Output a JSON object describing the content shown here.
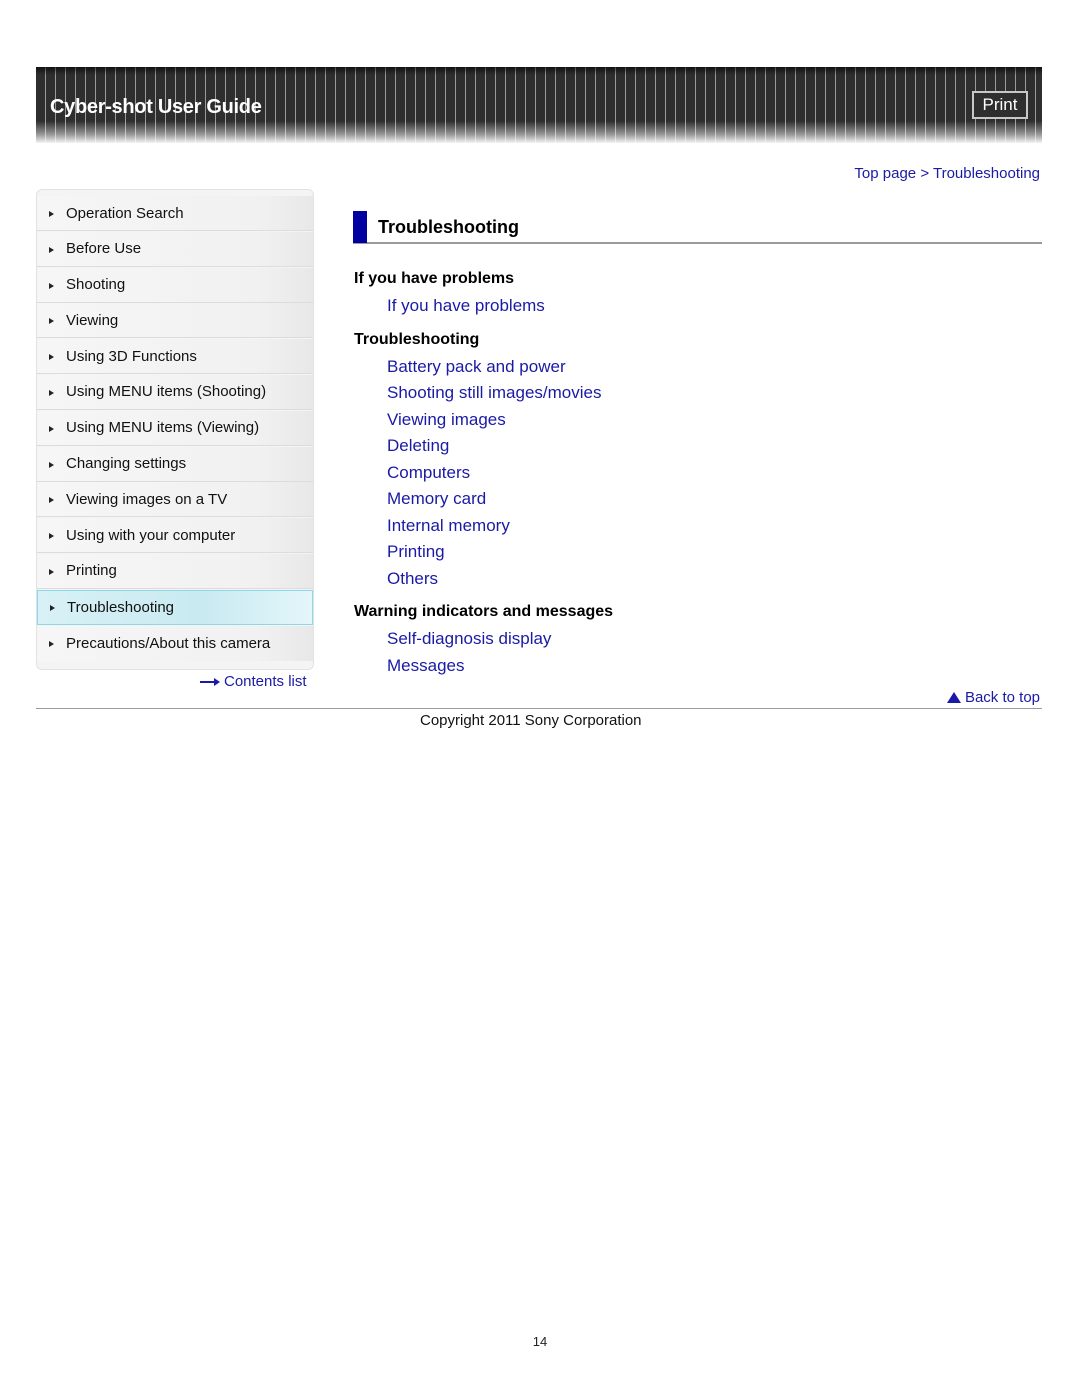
{
  "header": {
    "title": "Cyber-shot User Guide",
    "print_label": "Print"
  },
  "breadcrumb": {
    "items": [
      "Top page",
      "Troubleshooting"
    ],
    "separator": ">"
  },
  "sidebar": {
    "items": [
      {
        "label": "Operation Search"
      },
      {
        "label": "Before Use"
      },
      {
        "label": "Shooting"
      },
      {
        "label": "Viewing"
      },
      {
        "label": "Using 3D Functions"
      },
      {
        "label": "Using MENU items (Shooting)"
      },
      {
        "label": "Using MENU items (Viewing)"
      },
      {
        "label": "Changing settings"
      },
      {
        "label": "Viewing images on a TV"
      },
      {
        "label": "Using with your computer"
      },
      {
        "label": "Printing"
      },
      {
        "label": "Troubleshooting",
        "active": true
      },
      {
        "label": "Precautions/About this camera"
      }
    ],
    "contents_link": "Contents list"
  },
  "main": {
    "title": "Troubleshooting",
    "sections": [
      {
        "heading": "If you have problems",
        "links": [
          "If you have problems"
        ]
      },
      {
        "heading": "Troubleshooting",
        "links": [
          "Battery pack and power",
          "Shooting still images/movies",
          "Viewing images",
          "Deleting",
          "Computers",
          "Memory card",
          "Internal memory",
          "Printing",
          "Others"
        ]
      },
      {
        "heading": "Warning indicators and messages",
        "links": [
          "Self-diagnosis display",
          "Messages"
        ]
      }
    ],
    "back_to_top": "Back to top"
  },
  "footer": {
    "copyright": "Copyright 2011 Sony Corporation",
    "page_number": "14"
  },
  "colors": {
    "link": "#1a1aa6",
    "title_bar": "#0000a0",
    "header_bg": "#2e2e2e",
    "active_nav": "#c9eaf1"
  }
}
